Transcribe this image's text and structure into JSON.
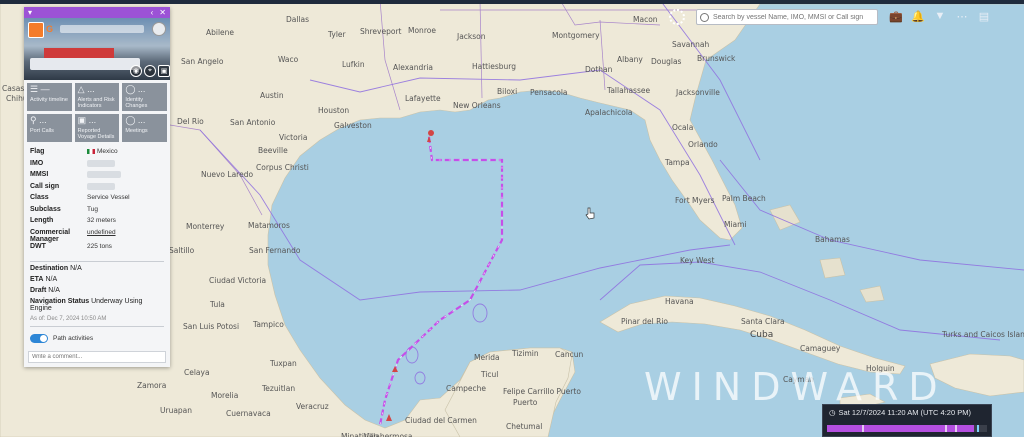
{
  "app": {
    "watermark": "WINDWARD"
  },
  "search": {
    "placeholder": "Search by vessel Name, IMO, MMSI or Call sign"
  },
  "toolbar": {
    "icons": [
      "briefcase-icon",
      "add-alert-icon",
      "filter-icon",
      "more-icon",
      "clipboard-icon"
    ]
  },
  "panel": {
    "tiles": [
      {
        "label": "Activity timeline",
        "value": "—",
        "icon": "list-icon"
      },
      {
        "label": "Alerts and Risk Indicators",
        "value": "...",
        "icon": "alert-icon"
      },
      {
        "label": "Identity Changes",
        "value": "...",
        "icon": "identity-icon"
      },
      {
        "label": "Port Calls",
        "value": "...",
        "icon": "pin-icon"
      },
      {
        "label": "Reported Voyage Details",
        "value": "...",
        "icon": "voyage-icon"
      },
      {
        "label": "Meetings",
        "value": "...",
        "icon": "meeting-icon"
      }
    ],
    "props": {
      "flag_label": "Flag",
      "flag_value": "Mexico",
      "imo_label": "IMO",
      "mmsi_label": "MMSI",
      "callsign_label": "Call sign",
      "class_label": "Class",
      "class_value": "Service Vessel",
      "subclass_label": "Subclass",
      "subclass_value": "Tug",
      "length_label": "Length",
      "length_value": "32 meters",
      "manager_label": "Commercial Manager",
      "manager_value": "undefined",
      "dwt_label": "DWT",
      "dwt_value": "225 tons"
    },
    "voyage": {
      "destination_label": "Destination",
      "destination_value": "N/A",
      "eta_label": "ETA",
      "eta_value": "N/A",
      "draft_label": "Draft",
      "draft_value": "N/A",
      "nav_label": "Navigation Status",
      "nav_value": "Underway Using Engine",
      "asof": "As of: Dec 7, 2024 10:50 AM"
    },
    "toggle_label": "Path activities",
    "comment_placeholder": "Write a comment..."
  },
  "timeline": {
    "datetime": "Sat 12/7/2024 11:20 AM (UTC 4:20 PM)",
    "progress": 0.92
  },
  "map": {
    "cities": [
      [
        "Dallas",
        286,
        15,
        0
      ],
      [
        "Tyler",
        328,
        30,
        0
      ],
      [
        "Shreveport",
        360,
        27,
        0
      ],
      [
        "Monroe",
        408,
        26,
        0
      ],
      [
        "Jackson",
        457,
        32,
        0
      ],
      [
        "Montgomery",
        552,
        31,
        0
      ],
      [
        "Macon",
        633,
        15,
        0
      ],
      [
        "Savannah",
        672,
        40,
        0
      ],
      [
        "Abilene",
        206,
        28,
        0
      ],
      [
        "Waco",
        278,
        55,
        0
      ],
      [
        "Lufkin",
        342,
        60,
        0
      ],
      [
        "Alexandria",
        393,
        63,
        0
      ],
      [
        "Hattiesburg",
        472,
        62,
        0
      ],
      [
        "Albany",
        617,
        55,
        0
      ],
      [
        "Douglas",
        651,
        57,
        0
      ],
      [
        "Brunswick",
        697,
        54,
        0
      ],
      [
        "San Angelo",
        181,
        57,
        0
      ],
      [
        "Dothan",
        585,
        65,
        0
      ],
      [
        "Austin",
        260,
        91,
        0
      ],
      [
        "Lafayette",
        405,
        94,
        0
      ],
      [
        "New Orleans",
        453,
        101,
        0
      ],
      [
        "Biloxi",
        497,
        87,
        0
      ],
      [
        "Pensacola",
        530,
        88,
        0
      ],
      [
        "Tallahassee",
        607,
        86,
        0
      ],
      [
        "Jacksonville",
        676,
        88,
        0
      ],
      [
        "Apalachicola",
        585,
        108,
        0
      ],
      [
        "Houston",
        318,
        106,
        0
      ],
      [
        "San Antonio",
        230,
        118,
        0
      ],
      [
        "Victoria",
        279,
        133,
        0
      ],
      [
        "Galveston",
        334,
        121,
        0
      ],
      [
        "Ocala",
        672,
        123,
        0
      ],
      [
        "Del Rio",
        177,
        117,
        0
      ],
      [
        "Orlando",
        688,
        140,
        0
      ],
      [
        "Beeville",
        258,
        146,
        0
      ],
      [
        "Corpus Christi",
        256,
        163,
        0
      ],
      [
        "Tampa",
        665,
        158,
        0
      ],
      [
        "Nuevo Laredo",
        201,
        170,
        0
      ],
      [
        "Palm Beach",
        722,
        194,
        0
      ],
      [
        "Fort Myers",
        675,
        196,
        0
      ],
      [
        "Miami",
        724,
        220,
        0
      ],
      [
        "Monterrey",
        186,
        222,
        0
      ],
      [
        "Matamoros",
        248,
        221,
        0
      ],
      [
        "San Fernando",
        249,
        246,
        0
      ],
      [
        "Key West",
        680,
        256,
        0
      ],
      [
        "Bahamas",
        815,
        235,
        0
      ],
      [
        "Saltillo",
        169,
        246,
        0
      ],
      [
        "Ciudad Victoria",
        209,
        276,
        0
      ],
      [
        "Havana",
        665,
        297,
        0
      ],
      [
        "Tula",
        210,
        300,
        0
      ],
      [
        "Pinar del Rio",
        621,
        317,
        0
      ],
      [
        "Santa Clara",
        741,
        317,
        0
      ],
      [
        "Cuba",
        750,
        330,
        1
      ],
      [
        "Camaguey",
        800,
        344,
        0
      ],
      [
        "Turks and Caicos Islands",
        942,
        330,
        0
      ],
      [
        "San Luis Potosi",
        183,
        322,
        0
      ],
      [
        "Tampico",
        253,
        320,
        0
      ],
      [
        "Holguin",
        866,
        364,
        0
      ],
      [
        "Merida",
        474,
        353,
        0
      ],
      [
        "Tizimin",
        512,
        349,
        0
      ],
      [
        "Cancun",
        555,
        350,
        0
      ],
      [
        "Cayman",
        783,
        375,
        0
      ],
      [
        "Tuxpan",
        270,
        359,
        0
      ],
      [
        "Ticul",
        481,
        370,
        0
      ],
      [
        "Zamora",
        137,
        381,
        0
      ],
      [
        "Campeche",
        446,
        384,
        0
      ],
      [
        "Felipe Carrillo Puerto",
        503,
        387,
        0
      ],
      [
        "Tezuitlan",
        262,
        384,
        0
      ],
      [
        "Celaya",
        184,
        368,
        0
      ],
      [
        "Morelia",
        211,
        391,
        0
      ],
      [
        "Cuernavaca",
        226,
        409,
        0
      ],
      [
        "Veracruz",
        296,
        402,
        0
      ],
      [
        "Puerto",
        513,
        398,
        0
      ],
      [
        "Ciudad del Carmen",
        405,
        416,
        0
      ],
      [
        "Villahermosa",
        364,
        432,
        0
      ],
      [
        "Minatitlan",
        341,
        432,
        0
      ],
      [
        "Uruapan",
        160,
        406,
        0
      ],
      [
        "Chetumal",
        506,
        422,
        0
      ],
      [
        "Casas",
        2,
        84,
        0
      ],
      [
        "Chihuahua",
        6,
        94,
        0
      ]
    ]
  }
}
